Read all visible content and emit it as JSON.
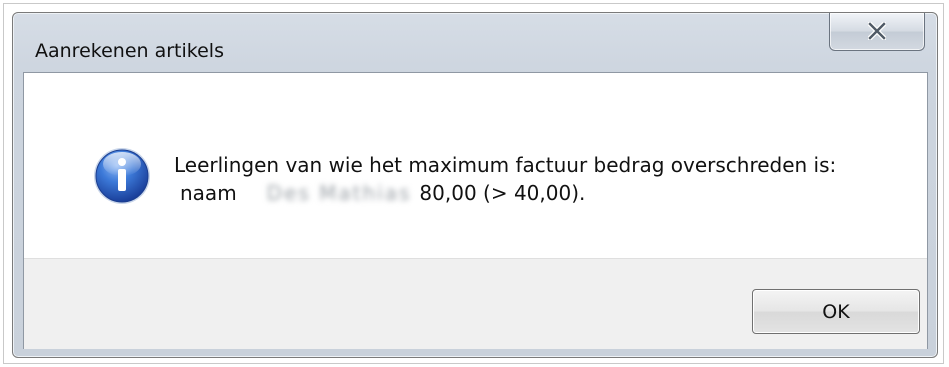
{
  "window": {
    "title": "Aanrekenen artikels",
    "close_icon": "close-icon"
  },
  "message": {
    "icon": "info-icon",
    "line1": "Leerlingen van wie het maximum factuur bedrag overschreden is:",
    "name_label": "naam",
    "redacted_name": "Des Mathias",
    "amount_text": "80,00 (> 40,00)."
  },
  "buttons": {
    "ok_label": "OK"
  },
  "colors": {
    "titlebar": "#cdd5df",
    "info_icon_blue": "#2a63c4",
    "footer": "#f0f0f0"
  }
}
